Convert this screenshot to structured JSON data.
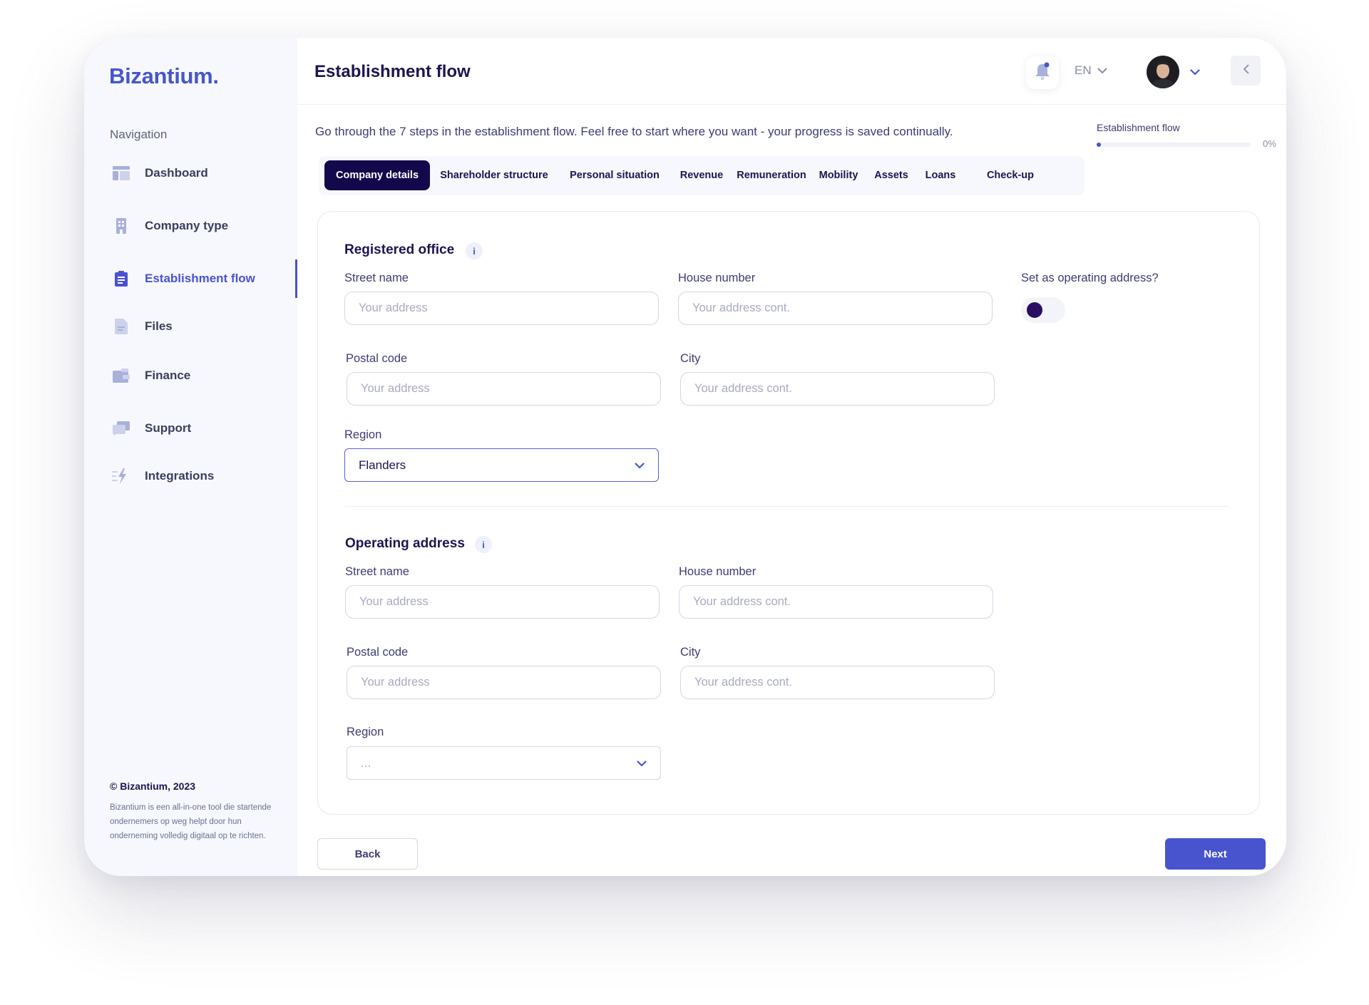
{
  "brand": {
    "logo": "Bizantium."
  },
  "sidebar": {
    "heading": "Navigation",
    "items": [
      {
        "label": "Dashboard",
        "icon": "dashboard-icon"
      },
      {
        "label": "Company type",
        "icon": "building-icon"
      },
      {
        "label": "Establishment flow",
        "icon": "clipboard-icon",
        "active": true
      },
      {
        "label": "Files",
        "icon": "file-icon"
      },
      {
        "label": "Finance",
        "icon": "wallet-icon"
      },
      {
        "label": "Support",
        "icon": "chat-icon"
      },
      {
        "label": "Integrations",
        "icon": "lightning-icon"
      }
    ],
    "footer_copy": "© Bizantium, 2023",
    "footer_text": "Bizantium is een all-in-one tool die startende ondernemers op weg helpt door hun onderneming volledig digitaal op te richten."
  },
  "header": {
    "title": "Establishment flow",
    "language": "EN"
  },
  "intro": "Go through the 7 steps in the establishment flow. Feel free to start where you want - your progress is saved continually.",
  "progress": {
    "label": "Establishment flow",
    "percent_text": "0%",
    "value": 0
  },
  "tabs": [
    {
      "label": "Company details",
      "active": true
    },
    {
      "label": "Shareholder structure"
    },
    {
      "label": "Personal situation"
    },
    {
      "label": "Revenue"
    },
    {
      "label": "Remuneration"
    },
    {
      "label": "Mobility"
    },
    {
      "label": "Assets"
    },
    {
      "label": "Loans"
    },
    {
      "label": "Check-up"
    }
  ],
  "registered_office": {
    "title": "Registered office",
    "street_label": "Street name",
    "street_placeholder": "Your address",
    "house_label": "House number",
    "house_placeholder": "Your address cont.",
    "operating_label": "Set as operating address?",
    "postal_label": "Postal code",
    "postal_placeholder": "Your address",
    "city_label": "City",
    "city_placeholder": "Your address cont.",
    "region_label": "Region",
    "region_value": "Flanders"
  },
  "operating_address": {
    "title": "Operating address",
    "street_label": "Street name",
    "street_placeholder": "Your address",
    "house_label": "House number",
    "house_placeholder": "Your address cont.",
    "postal_label": "Postal code",
    "postal_placeholder": "Your address",
    "city_label": "City",
    "city_placeholder": "Your address cont.",
    "region_label": "Region",
    "region_value": "..."
  },
  "actions": {
    "back": "Back",
    "next": "Next"
  },
  "colors": {
    "accent": "#4656c8",
    "tab_active": "#13084b",
    "toggle_knob": "#2a0e62"
  }
}
